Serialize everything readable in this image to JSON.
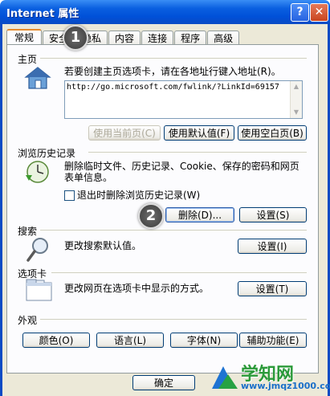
{
  "window": {
    "title": "Internet 属性",
    "help_label": "?",
    "close_label": "✕"
  },
  "tabs": [
    {
      "label": "常规",
      "active": true
    },
    {
      "label": "安全",
      "active": false
    },
    {
      "label": "隐私",
      "active": false
    },
    {
      "label": "内容",
      "active": false
    },
    {
      "label": "连接",
      "active": false
    },
    {
      "label": "程序",
      "active": false
    },
    {
      "label": "高级",
      "active": false
    }
  ],
  "home": {
    "section_label": "主页",
    "description": "若要创建主页选项卡，请在各地址行键入地址(R)。",
    "url_value": "http://go.microsoft.com/fwlink/?LinkId=69157",
    "use_current_label": "使用当前页(C)",
    "use_default_label": "使用默认值(F)",
    "use_blank_label": "使用空白页(B)"
  },
  "history": {
    "section_label": "浏览历史记录",
    "description_line1": "删除临时文件、历史记录、Cookie、保存的密码和网页",
    "description_line2": "表单信息。",
    "checkbox_label": "退出时删除浏览历史记录(W)",
    "delete_label": "删除(D)...",
    "settings_label": "设置(S)"
  },
  "search": {
    "section_label": "搜索",
    "description": "更改搜索默认值。",
    "settings_label": "设置(I)"
  },
  "tabs_section": {
    "section_label": "选项卡",
    "description": "更改网页在选项卡中显示的方式。",
    "settings_label": "设置(T)"
  },
  "appearance": {
    "section_label": "外观",
    "colors_label": "颜色(O)",
    "languages_label": "语言(L)",
    "fonts_label": "字体(N)",
    "accessibility_label": "辅助功能(E)"
  },
  "footer": {
    "ok_label": "确定"
  },
  "annotations": {
    "step1": "1",
    "step2": "2"
  },
  "watermark": {
    "brand": "学知网",
    "url": "www.jmqz1000.com"
  }
}
